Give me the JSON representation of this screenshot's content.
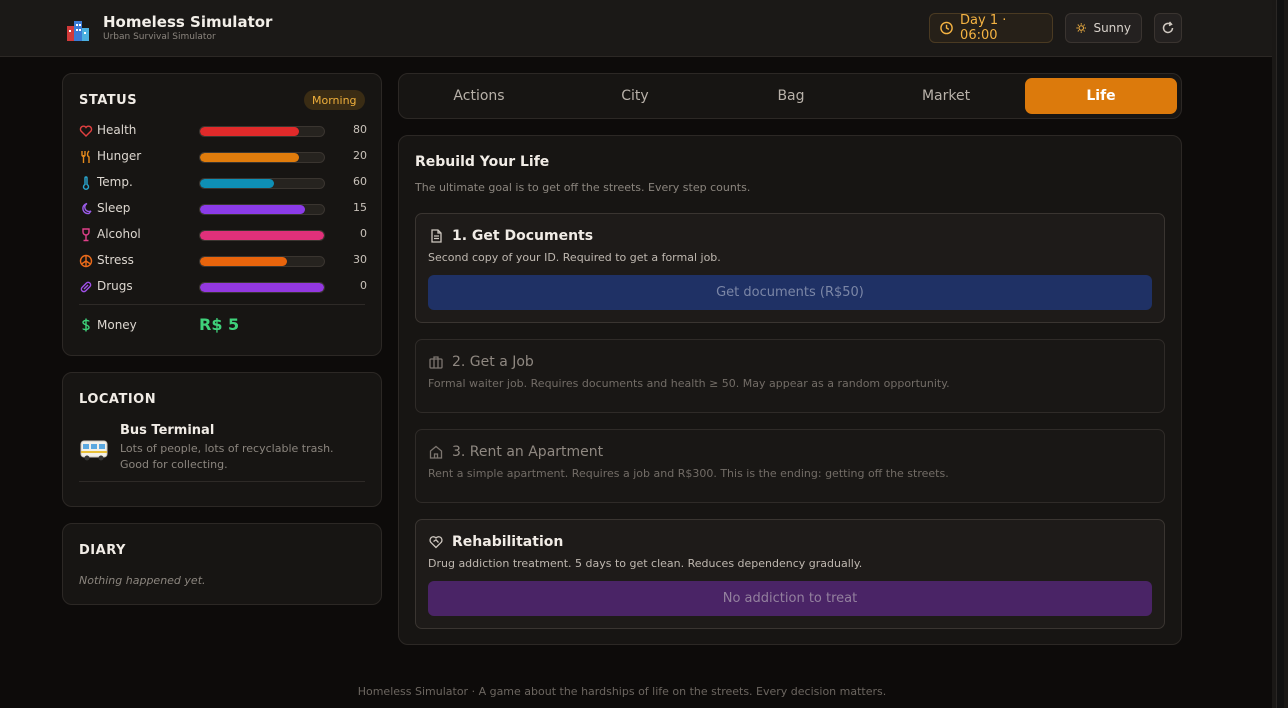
{
  "header": {
    "title": "Homeless Simulator",
    "subtitle": "Urban Survival Simulator",
    "day_time": "Day 1 · 06:00",
    "weather": "Sunny"
  },
  "status": {
    "title": "STATUS",
    "period": "Morning",
    "stats": [
      {
        "label": "Health",
        "value": "80",
        "fill": 80,
        "color": "#e02a2a"
      },
      {
        "label": "Hunger",
        "value": "20",
        "fill": 80,
        "color": "#e07c0c"
      },
      {
        "label": "Temp.",
        "value": "60",
        "fill": 60,
        "color": "#0e8fb5"
      },
      {
        "label": "Sleep",
        "value": "15",
        "fill": 85,
        "color": "#8b3be8"
      },
      {
        "label": "Alcohol",
        "value": "0",
        "fill": 100,
        "color": "#e0307a"
      },
      {
        "label": "Stress",
        "value": "30",
        "fill": 70,
        "color": "#e8640c"
      },
      {
        "label": "Drugs",
        "value": "0",
        "fill": 100,
        "color": "#9338e0"
      }
    ],
    "money_label": "Money",
    "money_value": "R$ 5"
  },
  "location": {
    "title": "LOCATION",
    "name": "Bus Terminal",
    "description": "Lots of people, lots of recyclable trash. Good for collecting."
  },
  "diary": {
    "title": "DIARY",
    "empty": "Nothing happened yet."
  },
  "tabs": [
    {
      "label": "Actions"
    },
    {
      "label": "City"
    },
    {
      "label": "Bag"
    },
    {
      "label": "Market"
    },
    {
      "label": "Life"
    }
  ],
  "life": {
    "title": "Rebuild Your Life",
    "subtitle": "The ultimate goal is to get off the streets. Every step counts.",
    "cards": [
      {
        "title": "1. Get Documents",
        "desc": "Second copy of your ID. Required to get a formal job.",
        "button": "Get documents (R$50)"
      },
      {
        "title": "2. Get a Job",
        "desc": "Formal waiter job. Requires documents and health ≥ 50. May appear as a random opportunity."
      },
      {
        "title": "3. Rent an Apartment",
        "desc": "Rent a simple apartment. Requires a job and R$300. This is the ending: getting off the streets."
      },
      {
        "title": "Rehabilitation",
        "desc": "Drug addiction treatment. 5 days to get clean. Reduces dependency gradually.",
        "button": "No addiction to treat"
      }
    ]
  },
  "footer": "Homeless Simulator · A game about the hardships of life on the streets. Every decision matters."
}
